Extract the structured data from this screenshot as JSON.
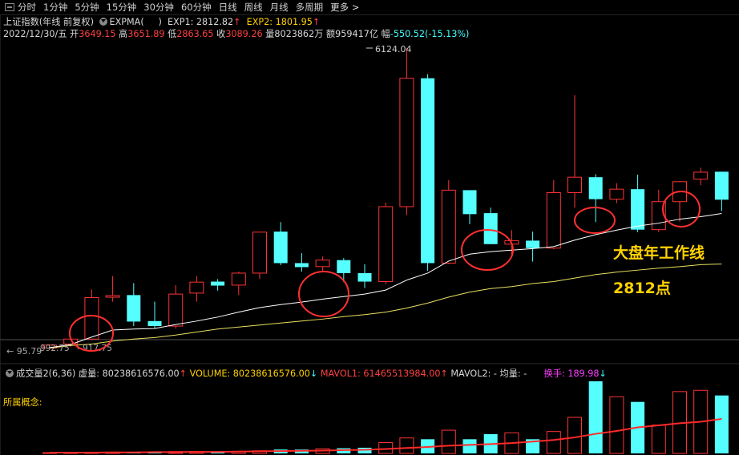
{
  "toolbar": {
    "items": [
      "分时",
      "1分钟",
      "5分钟",
      "15分钟",
      "30分钟",
      "60分钟",
      "日线",
      "周线",
      "月线",
      "多周期"
    ],
    "more": "更多"
  },
  "header": {
    "index_name": "上证指数(年线 前复权)",
    "indicator": "EXPMA(",
    "indicator_close": ")",
    "exp1": "EXP1: 2812.82",
    "exp2": "EXP2: 1801.95",
    "date": "2022/12/30/五",
    "open_label": "开",
    "open": "3649.15",
    "high_label": "高",
    "high": "3651.89",
    "low_label": "低",
    "low": "2863.65",
    "close_label": "收",
    "close": "3089.26",
    "vol_label": "量",
    "vol": "8023862万",
    "amt_label": "额",
    "amt": "959417亿",
    "chg_label": "幅",
    "chg": "-550.52(-15.13%)"
  },
  "annotations": {
    "peak_label": "6124.04",
    "low_label_1": "95.79",
    "low_label_2": "992.75",
    "low_label_3": "917.75",
    "line_label": "大盘年工作线",
    "point_label": "2812点"
  },
  "volume_panel": {
    "title": "成交量2(6,36)",
    "xuliang": "虚量: 80238616576.00",
    "volume": "VOLUME: 80238616576.00",
    "mavol1": "MAVOL1: 61465513984.00",
    "mavol2": "MAVOL2: -",
    "junliang": "均量: -",
    "huanshou": "换手: 189.98",
    "concept": "所属概念:"
  },
  "colors": {
    "up": "#ff3333",
    "down": "#55ffff",
    "exp1": "#ffffff",
    "exp2": "#e8e060",
    "circle": "#ff3030"
  },
  "chart_data": [
    {
      "type": "candlestick",
      "title": "上证指数(年线 前复权)",
      "ylim": [
        95.79,
        6124.04
      ],
      "candles": [
        {
          "o": 120,
          "h": 200,
          "l": 95,
          "c": 180,
          "dir": "up"
        },
        {
          "o": 200,
          "h": 320,
          "l": 150,
          "c": 300,
          "dir": "up"
        },
        {
          "o": 300,
          "h": 1290,
          "l": 280,
          "c": 1130,
          "dir": "up"
        },
        {
          "o": 1140,
          "h": 1560,
          "l": 1050,
          "c": 1170,
          "dir": "up"
        },
        {
          "o": 1180,
          "h": 1420,
          "l": 560,
          "c": 650,
          "dir": "down"
        },
        {
          "o": 660,
          "h": 1050,
          "l": 520,
          "c": 560,
          "dir": "down"
        },
        {
          "o": 560,
          "h": 1380,
          "l": 510,
          "c": 1200,
          "dir": "up"
        },
        {
          "o": 1220,
          "h": 1560,
          "l": 1050,
          "c": 1440,
          "dir": "up"
        },
        {
          "o": 1450,
          "h": 1500,
          "l": 1270,
          "c": 1370,
          "dir": "down"
        },
        {
          "o": 1380,
          "h": 1650,
          "l": 1180,
          "c": 1620,
          "dir": "up"
        },
        {
          "o": 1620,
          "h": 2400,
          "l": 1500,
          "c": 2440,
          "dir": "up"
        },
        {
          "o": 2450,
          "h": 2640,
          "l": 1780,
          "c": 1820,
          "dir": "down"
        },
        {
          "o": 1820,
          "h": 2020,
          "l": 1650,
          "c": 1740,
          "dir": "down"
        },
        {
          "o": 1750,
          "h": 1950,
          "l": 1650,
          "c": 1880,
          "dir": "up"
        },
        {
          "o": 1880,
          "h": 1920,
          "l": 1440,
          "c": 1620,
          "dir": "down"
        },
        {
          "o": 1620,
          "h": 1800,
          "l": 1320,
          "c": 1450,
          "dir": "down"
        },
        {
          "o": 1450,
          "h": 3030,
          "l": 1400,
          "c": 2950,
          "dir": "up"
        },
        {
          "o": 2950,
          "h": 6124.04,
          "l": 2780,
          "c": 5520,
          "dir": "up"
        },
        {
          "o": 5520,
          "h": 5600,
          "l": 1664,
          "c": 1820,
          "dir": "down"
        },
        {
          "o": 1820,
          "h": 3480,
          "l": 1800,
          "c": 3280,
          "dir": "up"
        },
        {
          "o": 3280,
          "h": 3260,
          "l": 2600,
          "c": 2800,
          "dir": "down"
        },
        {
          "o": 2820,
          "h": 2930,
          "l": 2200,
          "c": 2200,
          "dir": "down"
        },
        {
          "o": 2200,
          "h": 2480,
          "l": 1950,
          "c": 2270,
          "dir": "up"
        },
        {
          "o": 2270,
          "h": 2450,
          "l": 1850,
          "c": 2120,
          "dir": "down"
        },
        {
          "o": 2120,
          "h": 3480,
          "l": 2100,
          "c": 3230,
          "dir": "up"
        },
        {
          "o": 3230,
          "h": 5180,
          "l": 2930,
          "c": 3540,
          "dir": "up"
        },
        {
          "o": 3540,
          "h": 3600,
          "l": 2640,
          "c": 3100,
          "dir": "down"
        },
        {
          "o": 3100,
          "h": 3420,
          "l": 3020,
          "c": 3300,
          "dir": "up"
        },
        {
          "o": 3300,
          "h": 3590,
          "l": 2440,
          "c": 2490,
          "dir": "down"
        },
        {
          "o": 2490,
          "h": 3290,
          "l": 2440,
          "c": 3050,
          "dir": "up"
        },
        {
          "o": 3050,
          "h": 3460,
          "l": 2650,
          "c": 3450,
          "dir": "up"
        },
        {
          "o": 3500,
          "h": 3730,
          "l": 3380,
          "c": 3640,
          "dir": "up"
        },
        {
          "o": 3649.15,
          "h": 3651.89,
          "l": 2863.65,
          "c": 3089.26,
          "dir": "down"
        }
      ],
      "series": [
        {
          "name": "EXP1",
          "values": [
            130,
            190,
            340,
            480,
            500,
            510,
            590,
            660,
            740,
            840,
            930,
            990,
            1040,
            1100,
            1150,
            1200,
            1280,
            1480,
            1620,
            1860,
            2000,
            2050,
            2080,
            2110,
            2150,
            2280,
            2390,
            2480,
            2560,
            2620,
            2700,
            2750,
            2812.82
          ]
        },
        {
          "name": "EXP2",
          "values": [
            120,
            170,
            200,
            260,
            300,
            330,
            380,
            440,
            500,
            540,
            580,
            620,
            660,
            700,
            750,
            790,
            840,
            920,
            1020,
            1140,
            1240,
            1310,
            1350,
            1410,
            1450,
            1520,
            1590,
            1640,
            1680,
            1720,
            1750,
            1790,
            1801.95
          ]
        }
      ]
    },
    {
      "type": "bar",
      "title": "成交量2(6,36)",
      "values": [
        0.3,
        0.3,
        0.4,
        0.5,
        0.5,
        0.6,
        0.7,
        0.7,
        0.8,
        0.8,
        1.0,
        1.5,
        1.5,
        1.8,
        2.0,
        2.2,
        4.2,
        6.0,
        5.5,
        9.0,
        5.5,
        7.5,
        8.0,
        5.5,
        8.5,
        14.0,
        28.0,
        22.0,
        20.0,
        11.0,
        24.0,
        24.5,
        22.5
      ],
      "dirs": [
        "up",
        "up",
        "up",
        "up",
        "down",
        "down",
        "up",
        "up",
        "down",
        "up",
        "up",
        "down",
        "down",
        "up",
        "down",
        "down",
        "up",
        "up",
        "down",
        "up",
        "down",
        "down",
        "up",
        "down",
        "up",
        "up",
        "down",
        "up",
        "down",
        "up",
        "up",
        "up",
        "down"
      ],
      "mavol_values": [
        0.3,
        0.3,
        0.3,
        0.4,
        0.4,
        0.5,
        0.5,
        0.6,
        0.6,
        0.7,
        0.8,
        0.9,
        1.0,
        1.1,
        1.3,
        1.4,
        1.7,
        2.1,
        2.5,
        3.0,
        3.3,
        3.6,
        4.0,
        4.6,
        5.2,
        6.2,
        7.6,
        8.7,
        10.1,
        10.9,
        11.7,
        12.3,
        13.4
      ]
    }
  ]
}
